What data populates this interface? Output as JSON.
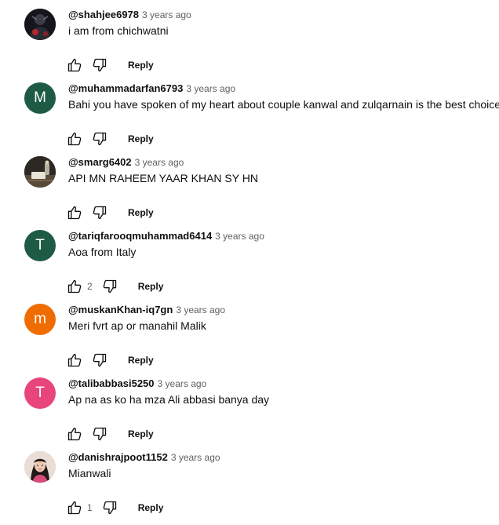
{
  "comments": [
    {
      "author": "@shahjee6978",
      "time": "3 years ago",
      "text": "i am from chichwatni",
      "likes": "",
      "reply_label": "Reply",
      "avatar": {
        "type": "photo",
        "letter": "",
        "color": "#1b1b22"
      }
    },
    {
      "author": "@muhammadarfan6793",
      "time": "3 years ago",
      "text": "Bahi you have spoken of my heart about couple kanwal and zulqarnain is the best choice",
      "likes": "",
      "reply_label": "Reply",
      "avatar": {
        "type": "letter",
        "letter": "M",
        "color": "#1e5b45"
      }
    },
    {
      "author": "@smarg6402",
      "time": "3 years ago",
      "text": "API MN RAHEEM YAAR KHAN SY HN",
      "likes": "",
      "reply_label": "Reply",
      "avatar": {
        "type": "photo",
        "letter": "",
        "color": "#3a3530"
      }
    },
    {
      "author": "@tariqfarooqmuhammad6414",
      "time": "3 years ago",
      "text": "Aoa from Italy",
      "likes": "2",
      "reply_label": "Reply",
      "avatar": {
        "type": "letter",
        "letter": "T",
        "color": "#1e5b45"
      }
    },
    {
      "author": "@muskanKhan-iq7gn",
      "time": "3 years ago",
      "text": "Meri fvrt ap or manahil Malik",
      "likes": "",
      "reply_label": "Reply",
      "avatar": {
        "type": "letter",
        "letter": "m",
        "color": "#ef6c00"
      }
    },
    {
      "author": "@talibabbasi5250",
      "time": "3 years ago",
      "text": "Ap na as ko ha mza Ali abbasi  banya day",
      "likes": "",
      "reply_label": "Reply",
      "avatar": {
        "type": "letter",
        "letter": "T",
        "color": "#e8457c"
      }
    },
    {
      "author": "@danishrajpoot1152",
      "time": "3 years ago",
      "text": "Mianwali",
      "likes": "1",
      "reply_label": "Reply",
      "avatar": {
        "type": "photo",
        "letter": "",
        "color": "#d9c2b4"
      }
    }
  ]
}
